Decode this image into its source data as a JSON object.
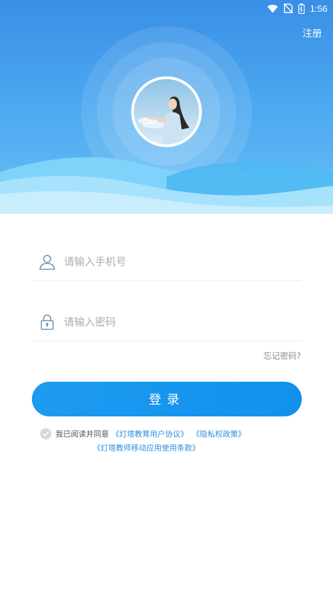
{
  "status_bar": {
    "time": "1:56",
    "icons": [
      "wifi-icon",
      "sim-off-icon",
      "battery-icon"
    ]
  },
  "header": {
    "register_label": "注册"
  },
  "form": {
    "phone_placeholder": "请输入手机号",
    "phone_value": "",
    "password_placeholder": "请输入密码",
    "password_value": "",
    "forgot_label": "忘记密码?",
    "login_label": "登录"
  },
  "agreement": {
    "prefix": "我已阅读并同意",
    "user_agreement": "《灯塔教育用户协议》",
    "privacy_policy": "《隐私权政策》",
    "teacher_terms": "《灯塔教师移动应用使用条款》",
    "checked": false
  },
  "colors": {
    "header_top": "#3a8fe6",
    "header_bottom": "#67c0f6",
    "button": "#1a96ee",
    "link": "#2b8fe0"
  }
}
